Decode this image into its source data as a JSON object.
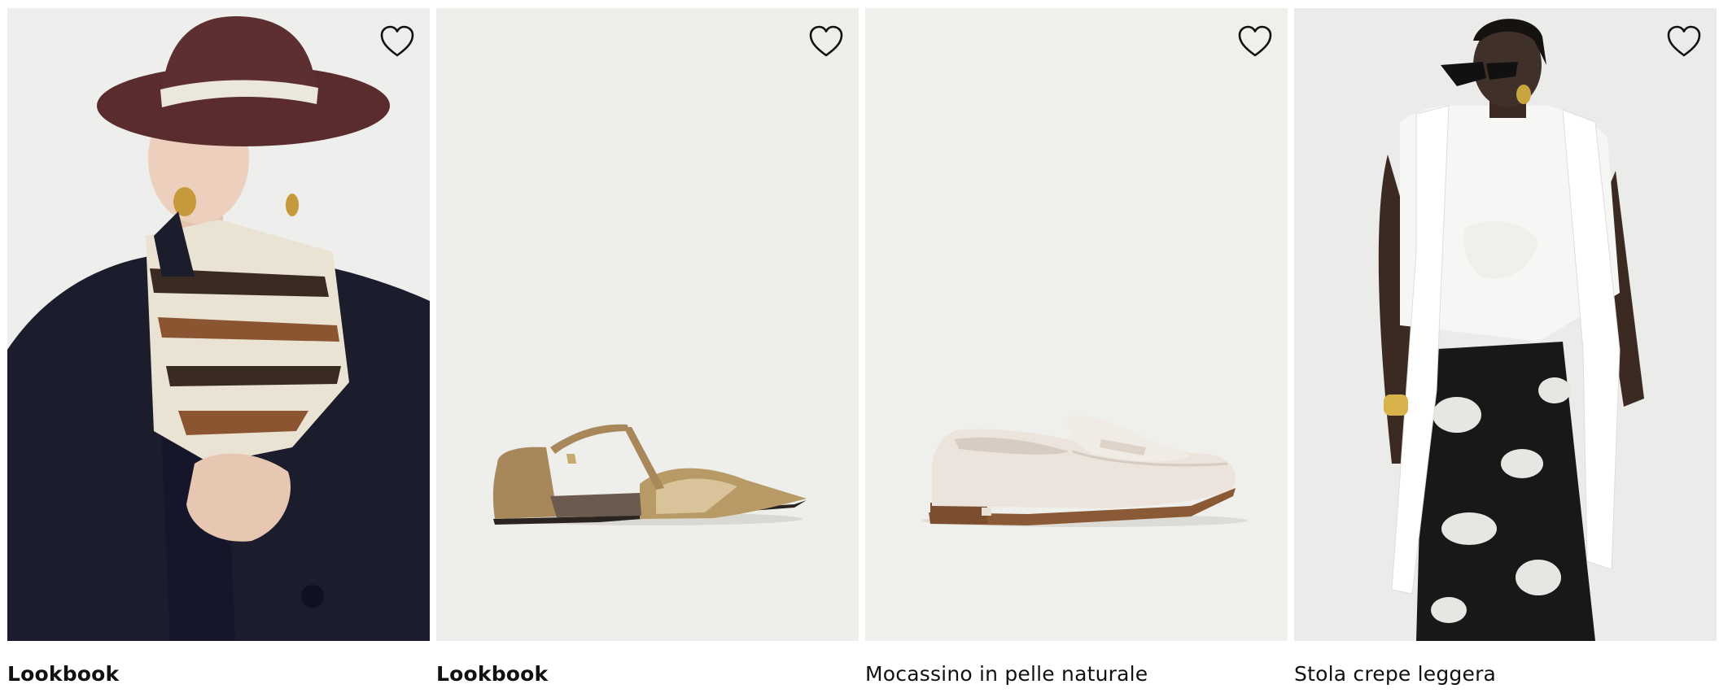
{
  "products": [
    {
      "title": "Lookbook",
      "bold": true,
      "image": "lookbook-hat-scarf-model",
      "wishlist_icon": "heart-outline-icon"
    },
    {
      "title": "Lookbook",
      "bold": true,
      "image": "metallic-pointed-flat-shoe",
      "wishlist_icon": "heart-outline-icon"
    },
    {
      "title": "Mocassino in pelle naturale",
      "bold": false,
      "image": "cream-leather-loafer",
      "wishlist_icon": "heart-outline-icon"
    },
    {
      "title": "Stola crepe leggera",
      "bold": false,
      "image": "white-stole-floral-skirt-model",
      "wishlist_icon": "heart-outline-icon"
    }
  ],
  "colors": {
    "background": "#ffffff",
    "image_background": "#efefec",
    "text": "#111111"
  }
}
